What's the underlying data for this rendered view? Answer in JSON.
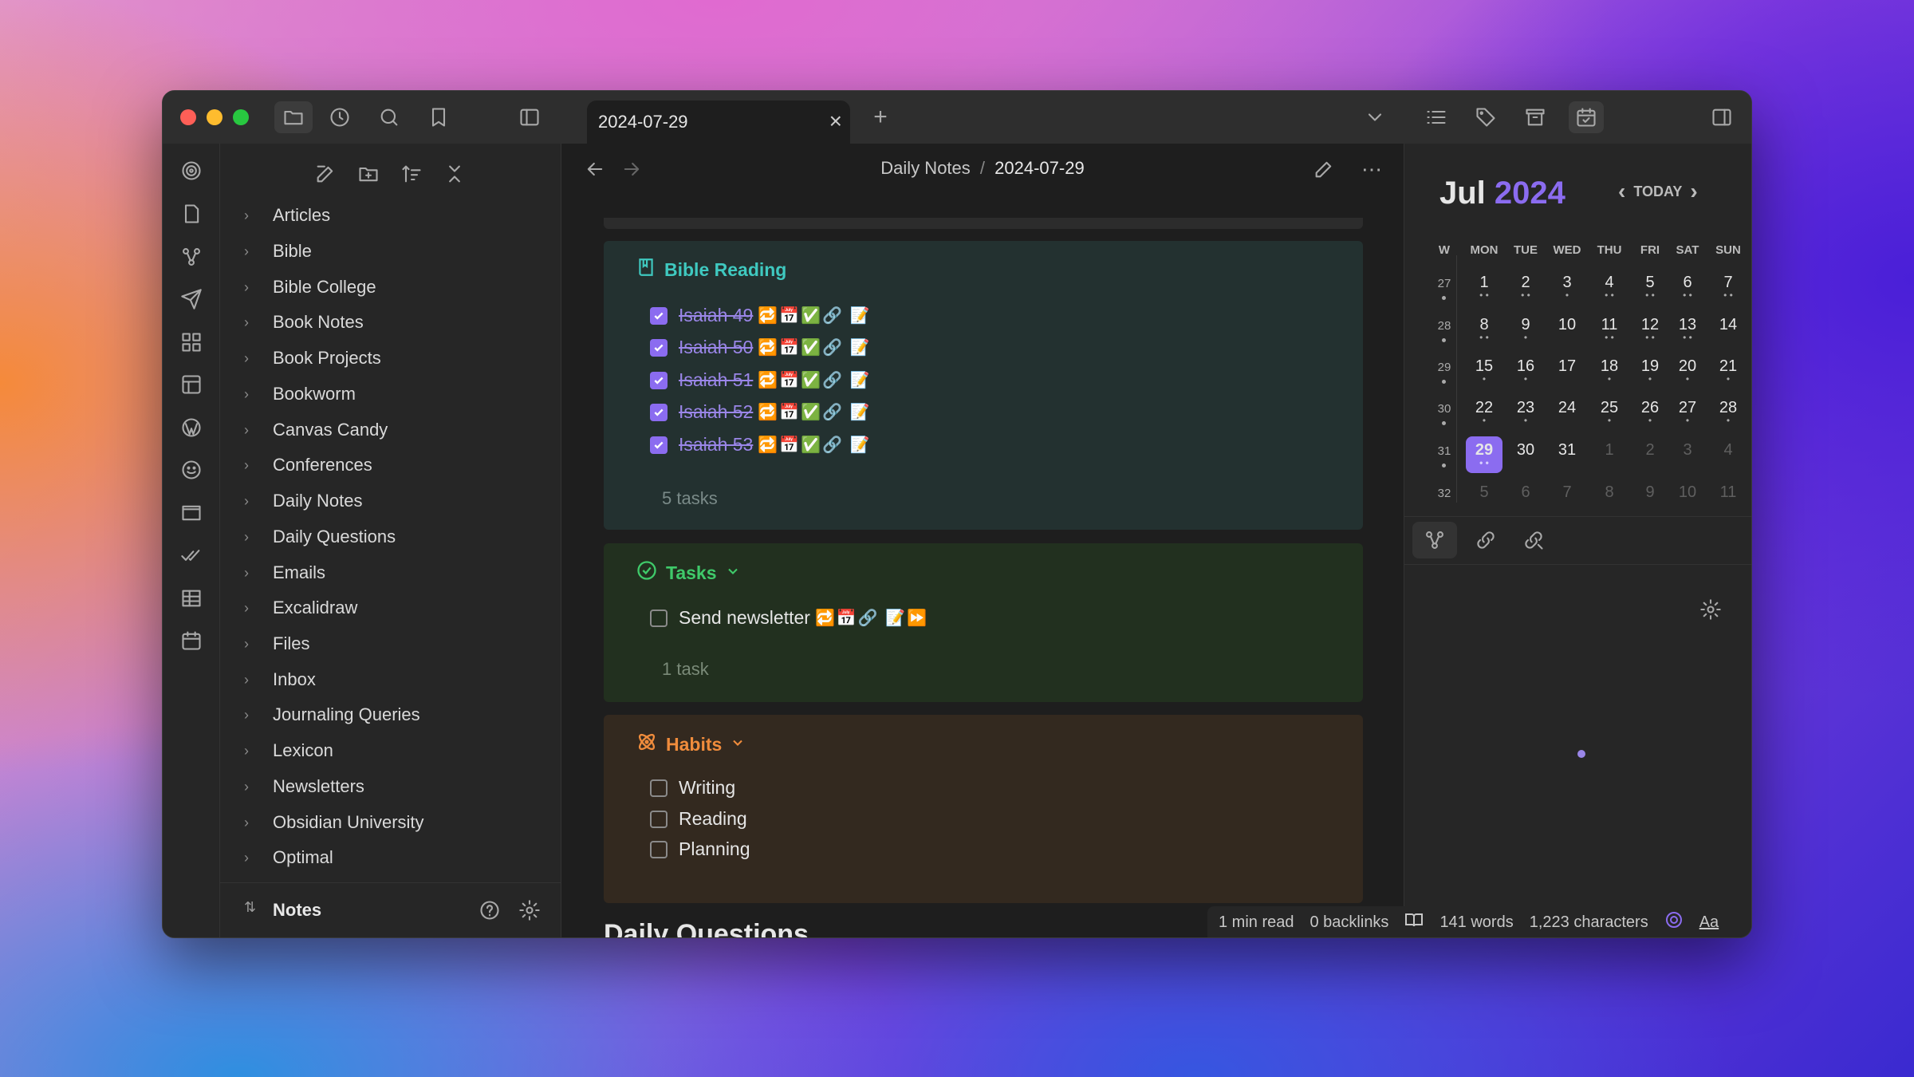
{
  "tab": {
    "title": "2024-07-29"
  },
  "breadcrumb": {
    "folder": "Daily Notes",
    "sep": "/",
    "note": "2024-07-29"
  },
  "sidebar": {
    "folders": [
      "Articles",
      "Bible",
      "Bible College",
      "Book Notes",
      "Book Projects",
      "Bookworm",
      "Canvas Candy",
      "Conferences",
      "Daily Notes",
      "Daily Questions",
      "Emails",
      "Excalidraw",
      "Files",
      "Inbox",
      "Journaling Queries",
      "Lexicon",
      "Newsletters",
      "Obsidian University",
      "Optimal"
    ],
    "vault": "Notes"
  },
  "bible": {
    "heading": "Bible Reading",
    "tasks": [
      "Isaiah 49",
      "Isaiah 50",
      "Isaiah 51",
      "Isaiah 52",
      "Isaiah 53"
    ],
    "count": "5 tasks",
    "emojis": "🔁📅✅🔗 📝"
  },
  "tasks": {
    "heading": "Tasks",
    "item": "Send newsletter",
    "emojis": "🔁📅🔗 📝⏩",
    "count": "1 task"
  },
  "habits": {
    "heading": "Habits",
    "items": [
      "Writing",
      "Reading",
      "Planning"
    ]
  },
  "next_heading": "Daily Questions",
  "calendar": {
    "month": "Jul",
    "year": "2024",
    "today": "TODAY",
    "headers": [
      "W",
      "MON",
      "TUE",
      "WED",
      "THU",
      "FRI",
      "SAT",
      "SUN"
    ],
    "weeks": [
      {
        "w": "27",
        "days": [
          "1",
          "2",
          "3",
          "4",
          "5",
          "6",
          "7"
        ]
      },
      {
        "w": "28",
        "days": [
          "8",
          "9",
          "10",
          "11",
          "12",
          "13",
          "14"
        ]
      },
      {
        "w": "29",
        "days": [
          "15",
          "16",
          "17",
          "18",
          "19",
          "20",
          "21"
        ]
      },
      {
        "w": "30",
        "days": [
          "22",
          "23",
          "24",
          "25",
          "26",
          "27",
          "28"
        ]
      },
      {
        "w": "31",
        "days": [
          "29",
          "30",
          "31",
          "1",
          "2",
          "3",
          "4"
        ]
      },
      {
        "w": "32",
        "days": [
          "5",
          "6",
          "7",
          "8",
          "9",
          "10",
          "11"
        ]
      }
    ]
  },
  "status": {
    "read": "1 min read",
    "backlinks": "0 backlinks",
    "words": "141 words",
    "chars": "1,223 characters",
    "font": "Aa"
  },
  "colors": {
    "accent": "#8b6cf0",
    "teal": "#3fc9c0",
    "green": "#3fca6a",
    "orange": "#f08c3c"
  }
}
